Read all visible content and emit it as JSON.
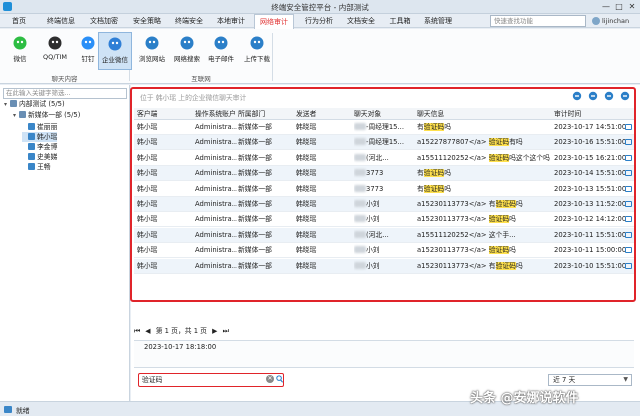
{
  "window": {
    "title": "终端安全管控平台 - 内部测试",
    "min": "—",
    "max": "□",
    "close": "✕"
  },
  "menu": {
    "tabs": [
      "首页",
      "终端信息",
      "文档加密",
      "安全策略",
      "终端安全",
      "本地审计",
      "网络审计",
      "行为分析",
      "文档安全",
      "工具箱",
      "系统管理"
    ],
    "active_index": 6,
    "search_placeholder": "快速查找功能",
    "user": "lijinchan"
  },
  "ribbon": {
    "items": [
      {
        "label": "微信",
        "icon": "wechat-icon",
        "color": "#2dbd43"
      },
      {
        "label": "QQ/TIM",
        "icon": "qq-icon",
        "color": "#2e2e2e"
      },
      {
        "label": "钉钉",
        "icon": "dingtalk-icon",
        "color": "#2a8ff7"
      },
      {
        "label": "企业微信",
        "icon": "wecom-icon",
        "color": "#2f7fd6"
      },
      {
        "label": "浏览网站",
        "icon": "browse-icon",
        "color": "#2b7fc8"
      },
      {
        "label": "网络搜索",
        "icon": "search-web-icon",
        "color": "#2b7fc8"
      },
      {
        "label": "电子邮件",
        "icon": "email-icon",
        "color": "#2b7fc8"
      },
      {
        "label": "上传下载",
        "icon": "cloud-transfer-icon",
        "color": "#2b7fc8"
      }
    ],
    "selected_index": 3,
    "groups": [
      "聊天内容",
      "互联网"
    ]
  },
  "tree": {
    "search_placeholder": "在此输入关键字筛选...",
    "nodes": [
      {
        "label": "内部测试 (5/5)",
        "level": 0
      },
      {
        "label": "新媒体一部 (5/5)",
        "level": 1
      },
      {
        "label": "崔丽丽",
        "level": 2
      },
      {
        "label": "韩小瑶",
        "level": 2
      },
      {
        "label": "李金博",
        "level": 2
      },
      {
        "label": "史美娣",
        "level": 2
      },
      {
        "label": "王畅",
        "level": 2
      }
    ],
    "selected_index": 3
  },
  "audit": {
    "hint": "位于 韩小瑶 上的企业微信聊天审计",
    "toolbar_icons": [
      "more-icon",
      "columns-icon",
      "refresh-icon",
      "export-icon"
    ],
    "columns": [
      "客户端",
      "操作系统账户",
      "所属部门",
      "发送者",
      "聊天对象",
      "聊天信息",
      "审计时间"
    ],
    "rows": [
      {
        "client": "韩小瑶",
        "account": "Administra...",
        "dept": "新媒体一部",
        "sender": "韩晓瑶",
        "target": "-周经理15...",
        "msg_pre": "有",
        "msg_hl": "验证码",
        "msg_post": "吗",
        "time": "2023-10-17 14:51:00"
      },
      {
        "client": "韩小瑶",
        "account": "Administra...",
        "dept": "新媒体一部",
        "sender": "韩晓瑶",
        "target": "-周经理15...",
        "msg_pre": "a15227877807</a> ",
        "msg_hl": "验证码",
        "msg_post": "有吗",
        "time": "2023-10-16 15:51:00"
      },
      {
        "client": "韩小瑶",
        "account": "Administra...",
        "dept": "新媒体一部",
        "sender": "韩晓瑶",
        "target": "(河北...",
        "msg_pre": "a15511120252</a> ",
        "msg_hl": "验证码",
        "msg_post": "吗这个这个吗",
        "time": "2023-10-15 16:21:00"
      },
      {
        "client": "韩小瑶",
        "account": "Administra...",
        "dept": "新媒体一部",
        "sender": "韩晓瑶",
        "target": "3773",
        "msg_pre": "有",
        "msg_hl": "验证码",
        "msg_post": "吗",
        "time": "2023-10-14 15:51:00"
      },
      {
        "client": "韩小瑶",
        "account": "Administra...",
        "dept": "新媒体一部",
        "sender": "韩晓瑶",
        "target": "3773",
        "msg_pre": "有",
        "msg_hl": "验证码",
        "msg_post": "吗",
        "time": "2023-10-13 15:51:00"
      },
      {
        "client": "韩小瑶",
        "account": "Administra...",
        "dept": "新媒体一部",
        "sender": "韩晓瑶",
        "target": "小刘",
        "msg_pre": "a15230113773</a> 有",
        "msg_hl": "验证码",
        "msg_post": "吗",
        "time": "2023-10-13 11:52:00"
      },
      {
        "client": "韩小瑶",
        "account": "Administra...",
        "dept": "新媒体一部",
        "sender": "韩晓瑶",
        "target": "小刘",
        "msg_pre": "a15230113773</a> ",
        "msg_hl": "验证码",
        "msg_post": "吗",
        "time": "2023-10-12 14:12:00"
      },
      {
        "client": "韩小瑶",
        "account": "Administra...",
        "dept": "新媒体一部",
        "sender": "韩晓瑶",
        "target": "(河北...",
        "msg_pre": "a15511120252</a> 这个手...",
        "msg_hl": "",
        "msg_post": "",
        "time": "2023-10-11 15:51:00"
      },
      {
        "client": "韩小瑶",
        "account": "Administra...",
        "dept": "新媒体一部",
        "sender": "韩晓瑶",
        "target": "小刘",
        "msg_pre": "a15230113773</a> ",
        "msg_hl": "验证码",
        "msg_post": "吗",
        "time": "2023-10-11 15:00:00"
      },
      {
        "client": "韩小瑶",
        "account": "Administra...",
        "dept": "新媒体一部",
        "sender": "韩晓瑶",
        "target": "小刘",
        "msg_pre": "a15230113773</a> 有",
        "msg_hl": "验证码",
        "msg_post": "吗",
        "time": "2023-10-10 15:51:00"
      }
    ]
  },
  "pager": {
    "first": "⏮",
    "prev": "◀",
    "text": "第 1 页，共 1 页",
    "next": "▶",
    "last": "⏭"
  },
  "detail": {
    "time": "2023-10-17 18:18:00"
  },
  "filter": {
    "keyword": "验证码",
    "range": "近 7 天"
  },
  "status": {
    "text": "就绪"
  },
  "watermark": "头条 @安娜说软件"
}
